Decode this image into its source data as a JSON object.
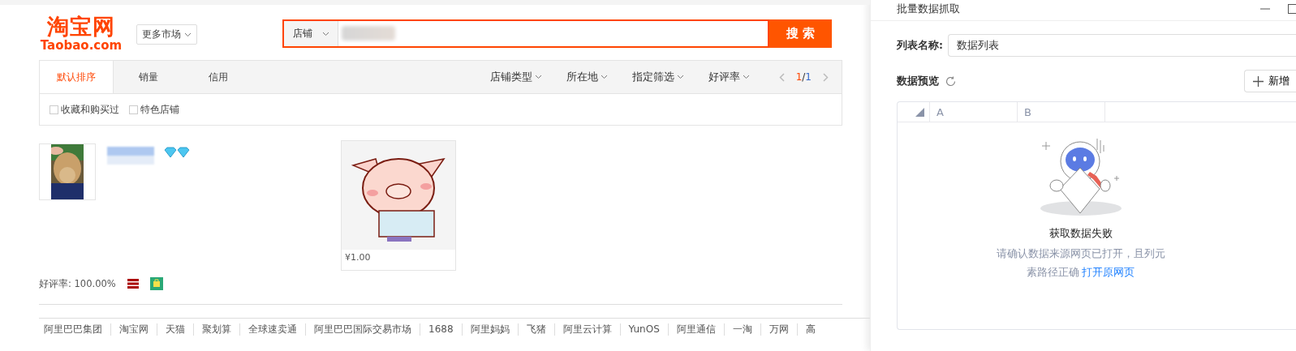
{
  "header": {
    "logo_cn": "淘宝网",
    "logo_en": "Taobao.com",
    "market_button": "更多市场",
    "search": {
      "scope": "店铺",
      "button": "搜 索"
    }
  },
  "sort_tabs": [
    {
      "label": "默认排序",
      "selected": true
    },
    {
      "label": "销量",
      "selected": false
    },
    {
      "label": "信用",
      "selected": false
    }
  ],
  "filters": [
    "店铺类型",
    "所在地",
    "指定筛选",
    "好评率"
  ],
  "pager": {
    "current": "1",
    "separator": "/",
    "total": "1"
  },
  "options": [
    {
      "label": "收藏和购买过",
      "checked": false
    },
    {
      "label": "特色店铺",
      "checked": false
    }
  ],
  "shop": {
    "product_price": "¥1.00",
    "rating": "好评率: 100.00%"
  },
  "footer_links": [
    "阿里巴巴集团",
    "淘宝网",
    "天猫",
    "聚划算",
    "全球速卖通",
    "阿里巴巴国际交易市场",
    "1688",
    "阿里妈妈",
    "飞猪",
    "阿里云计算",
    "YunOS",
    "阿里通信",
    "一淘",
    "万网",
    "高"
  ],
  "panel": {
    "title": "批量数据抓取",
    "list_name_label": "列表名称:",
    "list_name_value": "数据列表",
    "preview_label": "数据预览",
    "add_button": "新增",
    "table": {
      "columns": [
        "A",
        "B"
      ]
    },
    "empty": {
      "title": "获取数据失败",
      "message": "请确认数据来源网页已打开，且列元素路径正确",
      "link": "打开原网页"
    }
  }
}
